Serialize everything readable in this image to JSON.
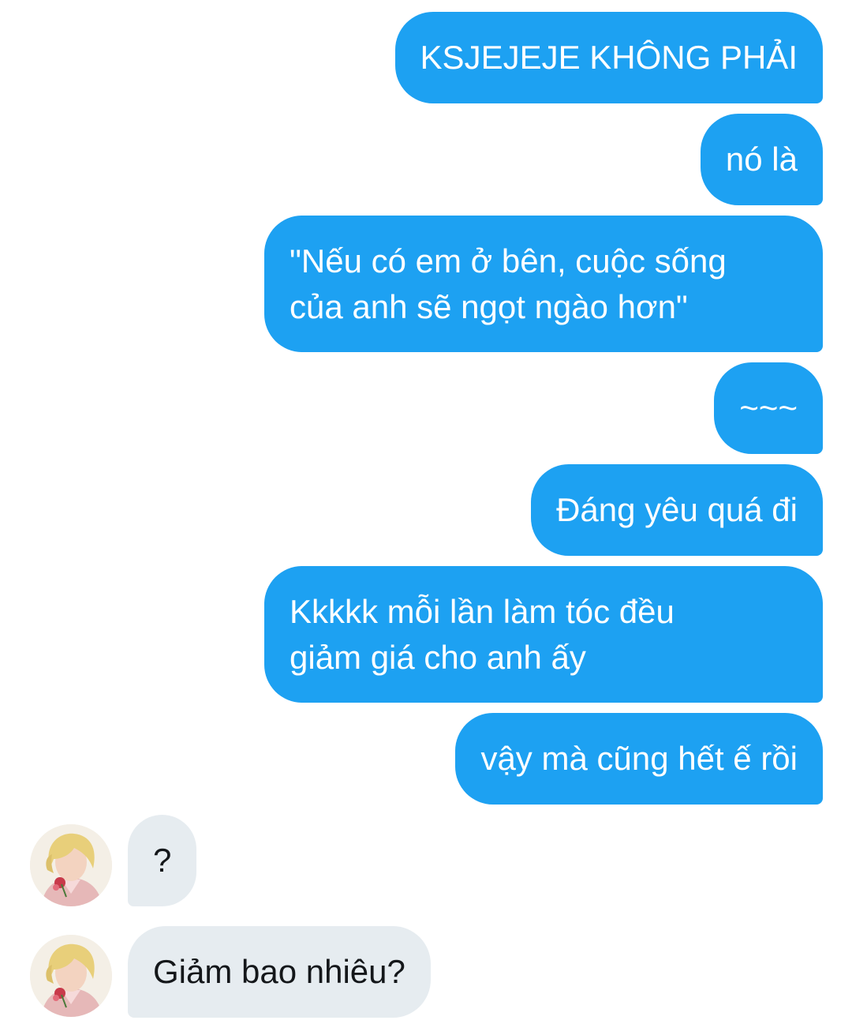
{
  "conversation": {
    "sent_messages": [
      {
        "lines": [
          "KSJEJEJE KHÔNG PHẢI"
        ]
      },
      {
        "lines": [
          "nó là"
        ]
      },
      {
        "lines": [
          "\"Nếu có em ở bên, cuộc sống",
          "của anh sẽ ngọt ngào hơn\""
        ]
      },
      {
        "lines": [
          "~~~"
        ]
      },
      {
        "lines": [
          "Đáng yêu quá đi"
        ]
      },
      {
        "lines": [
          "Kkkkk mỗi lần làm tóc đều",
          "giảm giá cho anh ấy"
        ]
      },
      {
        "lines": [
          "vậy mà cũng hết ế rồi"
        ]
      }
    ],
    "received_messages": [
      {
        "lines": [
          "?"
        ]
      },
      {
        "lines": [
          "Giảm bao nhiêu?"
        ]
      }
    ]
  },
  "colors": {
    "sent_bubble": "#1da1f2",
    "sent_text": "#ffffff",
    "received_bubble": "#e6ecf0",
    "received_text": "#14171a"
  },
  "icons": {
    "avatar": "user-avatar-image"
  }
}
